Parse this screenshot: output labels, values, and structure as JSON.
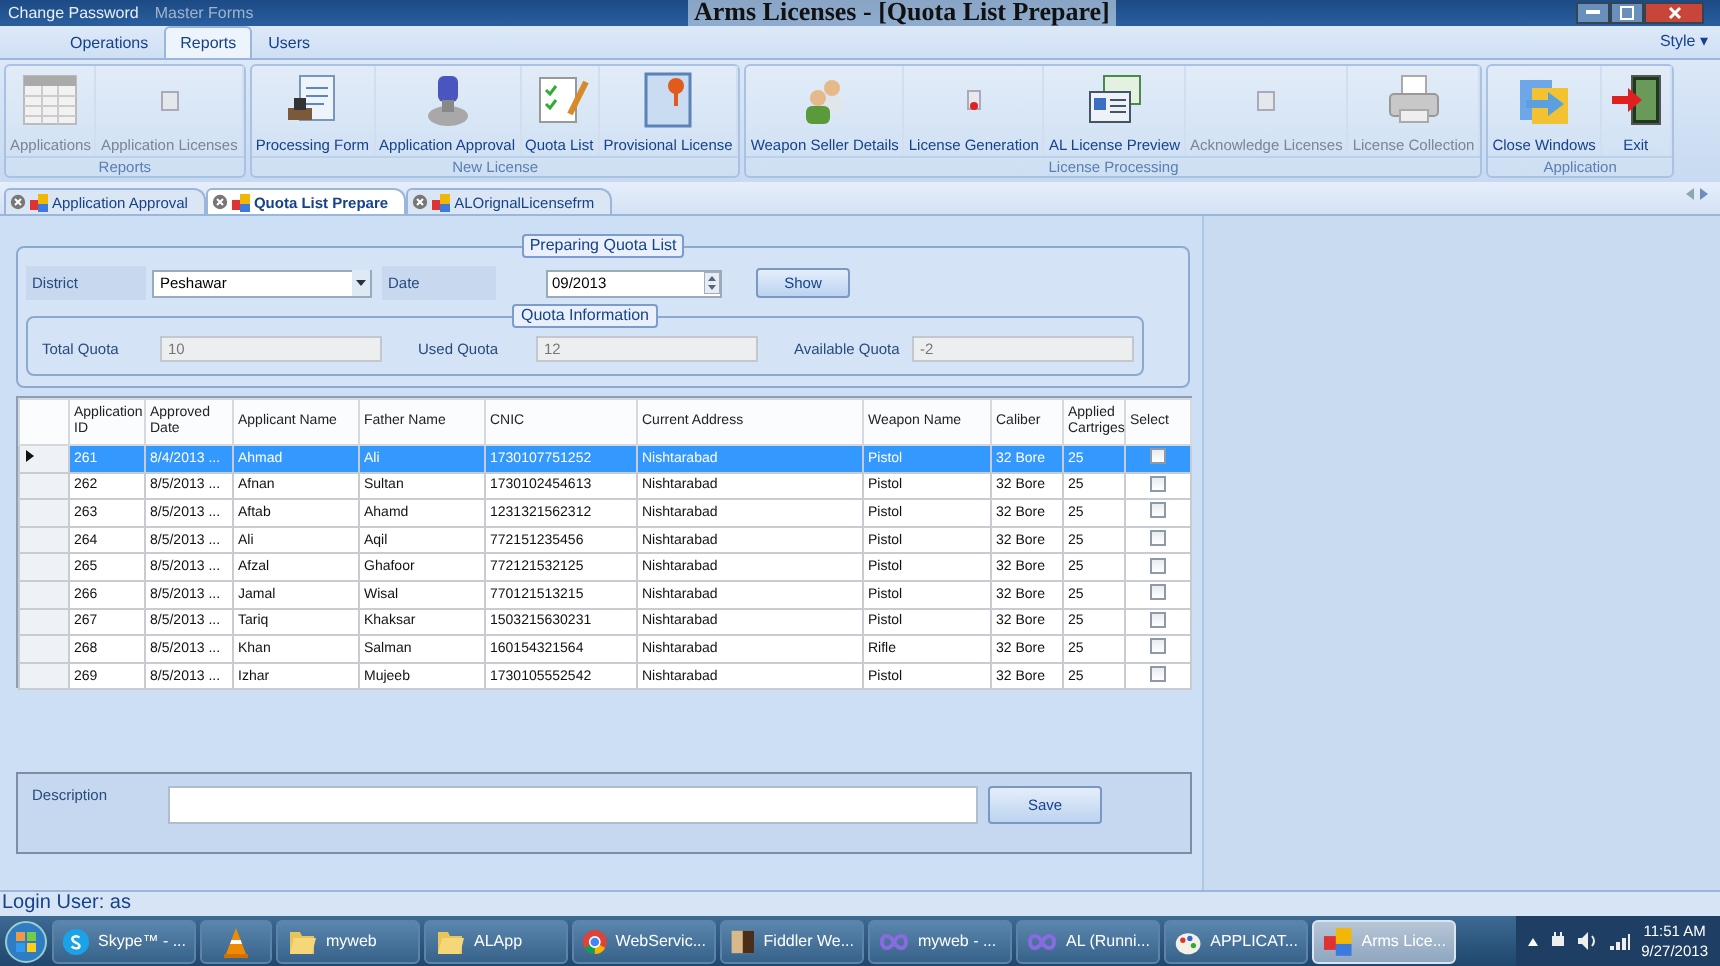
{
  "title_bar": {
    "quick_access": [
      "Change Password",
      "Master Forms"
    ],
    "title": "Arms Licenses - [Quota List Prepare]"
  },
  "ribbon": {
    "tabs": [
      {
        "label": "Operations",
        "selected": false
      },
      {
        "label": "Reports",
        "selected": true
      },
      {
        "label": "Users",
        "selected": false
      }
    ],
    "style_menu": "Style",
    "style_caret": "▾",
    "groups": [
      {
        "title": "Reports",
        "buttons": [
          {
            "label": "Applications",
            "kind": "grid",
            "disabled": true
          },
          {
            "label": "Application Licenses",
            "kind": "small-doc",
            "disabled": true
          }
        ]
      },
      {
        "title": "New License",
        "buttons": [
          {
            "label": "Processing Form",
            "kind": "form",
            "disabled": false
          },
          {
            "label": "Application Approval",
            "kind": "stamp",
            "disabled": false
          },
          {
            "label": "Quota List",
            "kind": "checklist",
            "disabled": false
          },
          {
            "label": "Provisional License",
            "kind": "certificate",
            "disabled": false
          }
        ]
      },
      {
        "title": "License Processing",
        "buttons": [
          {
            "label": "Weapon Seller Details",
            "kind": "people",
            "disabled": false
          },
          {
            "label": "License Generation",
            "kind": "small-red",
            "disabled": false
          },
          {
            "label": "AL License Preview",
            "kind": "cards",
            "disabled": false
          },
          {
            "label": "Acknowledge Licenses",
            "kind": "small-doc",
            "disabled": true
          },
          {
            "label": "License Collection",
            "kind": "printer",
            "disabled": true
          }
        ]
      },
      {
        "title": "Application",
        "buttons": [
          {
            "label": "Close Windows",
            "kind": "folder",
            "disabled": false
          },
          {
            "label": "Exit",
            "kind": "exit",
            "disabled": false
          }
        ]
      }
    ]
  },
  "doc_tabs": [
    {
      "label": "Application Approval",
      "selected": false
    },
    {
      "label": "Quota List Prepare",
      "selected": true
    },
    {
      "label": "ALOrignalLicensefrm",
      "selected": false
    }
  ],
  "form": {
    "title": "Preparing Quota List",
    "district_label": "District",
    "district": "Peshawar",
    "date_label": "Date",
    "date": "09/2013",
    "show_button": "Show",
    "quota_info": {
      "title": "Quota Information",
      "fields": [
        {
          "label": "Total Quota",
          "value": "10"
        },
        {
          "label": "Used Quota",
          "value": "12"
        },
        {
          "label": "Available Quota",
          "value": "-2"
        }
      ]
    }
  },
  "table": {
    "columns": [
      "Application ID",
      "Approved Date",
      "Applicant Name",
      "Father Name",
      "CNIC",
      "Current Address",
      "Weapon Name",
      "Caliber",
      "Applied Cartriges",
      "Select"
    ],
    "rows": [
      {
        "cells": [
          "261",
          "8/4/2013 ...",
          "Ahmad",
          "Ali",
          "1730107751252",
          "Nishtarabad",
          "Pistol",
          "32 Bore",
          "25"
        ],
        "checked": false,
        "selected": true
      },
      {
        "cells": [
          "262",
          "8/5/2013 ...",
          "Afnan",
          "Sultan",
          "1730102454613",
          "Nishtarabad",
          "Pistol",
          "32 Bore",
          "25"
        ],
        "checked": false,
        "selected": false
      },
      {
        "cells": [
          "263",
          "8/5/2013 ...",
          "Aftab",
          "Ahamd",
          "1231321562312",
          "Nishtarabad",
          "Pistol",
          "32 Bore",
          "25"
        ],
        "checked": false,
        "selected": false
      },
      {
        "cells": [
          "264",
          "8/5/2013 ...",
          "Ali",
          "Aqil",
          "772151235456",
          "Nishtarabad",
          "Pistol",
          "32 Bore",
          "25"
        ],
        "checked": false,
        "selected": false
      },
      {
        "cells": [
          "265",
          "8/5/2013 ...",
          "Afzal",
          "Ghafoor",
          "772121532125",
          "Nishtarabad",
          "Pistol",
          "32 Bore",
          "25"
        ],
        "checked": false,
        "selected": false
      },
      {
        "cells": [
          "266",
          "8/5/2013 ...",
          "Jamal",
          "Wisal",
          "770121513215",
          "Nishtarabad",
          "Pistol",
          "32 Bore",
          "25"
        ],
        "checked": false,
        "selected": false
      },
      {
        "cells": [
          "267",
          "8/5/2013 ...",
          "Tariq",
          "Khaksar",
          "1503215630231",
          "Nishtarabad",
          "Pistol",
          "32 Bore",
          "25"
        ],
        "checked": false,
        "selected": false
      },
      {
        "cells": [
          "268",
          "8/5/2013 ...",
          "Khan",
          "Salman",
          "160154321564",
          "Nishtarabad",
          "Rifle",
          "32 Bore",
          "25"
        ],
        "checked": false,
        "selected": false
      },
      {
        "cells": [
          "269",
          "8/5/2013 ...",
          "Izhar",
          "Mujeeb",
          "1730105552542",
          "Nishtarabad",
          "Pistol",
          "32 Bore",
          "25"
        ],
        "checked": false,
        "selected": false
      }
    ]
  },
  "description": {
    "label": "Description",
    "save_button": "Save"
  },
  "status_bar": "Login User: as",
  "taskbar": {
    "items": [
      {
        "kind": "start"
      },
      {
        "kind": "skype",
        "label": "Skype™ - ...",
        "selected": false
      },
      {
        "kind": "vlc",
        "selected": false
      },
      {
        "kind": "folder",
        "label": "myweb",
        "selected": false
      },
      {
        "kind": "folder",
        "label": "ALApp",
        "selected": false
      },
      {
        "kind": "chrome",
        "label": "WebServic...",
        "selected": false
      },
      {
        "kind": "fiddler",
        "label": "Fiddler We...",
        "selected": false
      },
      {
        "kind": "vs",
        "label": "myweb - ...",
        "selected": false
      },
      {
        "kind": "vs",
        "label": "AL (Runni...",
        "selected": false
      },
      {
        "kind": "paint",
        "label": "APPLICAT...",
        "selected": false
      },
      {
        "kind": "app",
        "label": "Arms Lice...",
        "selected": true
      }
    ],
    "time": "11:51 AM",
    "date": "9/27/2013"
  }
}
